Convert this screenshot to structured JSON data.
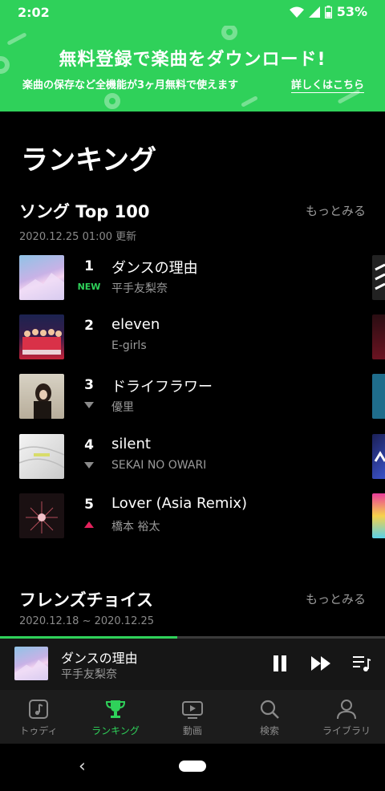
{
  "status": {
    "time": "2:02",
    "battery": "53%"
  },
  "banner": {
    "title": "無料登録で楽曲をダウンロード!",
    "subtitle": "楽曲の保存など全機能が3ヶ月無料で使えます",
    "link": "詳しくはこちら"
  },
  "page": {
    "title": "ランキング"
  },
  "songs_section": {
    "title": "ソング Top 100",
    "more": "もっとみる",
    "updated": "2020.12.25 01:00 更新",
    "items": [
      {
        "rank": "1",
        "badge": "NEW",
        "trend": "new",
        "title": "ダンスの理由",
        "artist": "平手友梨奈"
      },
      {
        "rank": "2",
        "badge": "",
        "trend": "same",
        "title": "eleven",
        "artist": "E-girls"
      },
      {
        "rank": "3",
        "badge": "",
        "trend": "down",
        "title": "ドライフラワー",
        "artist": "優里"
      },
      {
        "rank": "4",
        "badge": "",
        "trend": "down",
        "title": "silent",
        "artist": "SEKAI NO OWARI"
      },
      {
        "rank": "5",
        "badge": "",
        "trend": "up",
        "title": "Lover (Asia Remix)",
        "artist": "橋本 裕太"
      }
    ]
  },
  "friends_section": {
    "title": "フレンズチョイス",
    "more": "もっとみる",
    "date_range": "2020.12.18 ~ 2020.12.25"
  },
  "player": {
    "title": "ダンスの理由",
    "artist": "平手友梨奈",
    "progress": 0.46
  },
  "tabs": [
    {
      "label": "トゥディ",
      "icon": "music-note-icon",
      "active": false
    },
    {
      "label": "ランキング",
      "icon": "trophy-icon",
      "active": true
    },
    {
      "label": "動画",
      "icon": "video-icon",
      "active": false
    },
    {
      "label": "検索",
      "icon": "search-icon",
      "active": false
    },
    {
      "label": "ライブラリ",
      "icon": "person-icon",
      "active": false
    }
  ],
  "colors": {
    "accent": "#2fd15a",
    "up": "#e3225c",
    "muted": "#8a8a8a"
  }
}
